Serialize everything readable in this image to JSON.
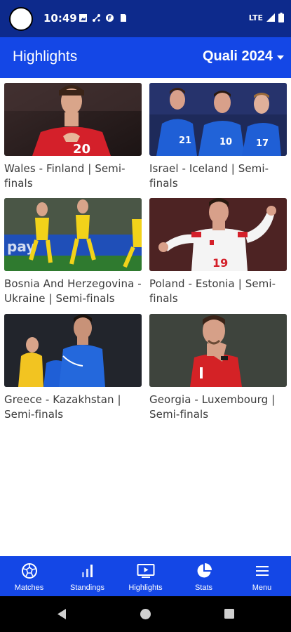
{
  "status_bar": {
    "time": "10:49",
    "network": "LTE"
  },
  "app_bar": {
    "title": "Highlights",
    "season": "Quali 2024"
  },
  "highlights": [
    {
      "caption": "Wales - Finland | Semi-finals"
    },
    {
      "caption": "Israel - Iceland | Semi-finals"
    },
    {
      "caption": "Bosnia And Herzegovina - Ukraine | Semi-finals"
    },
    {
      "caption": "Poland - Estonia | Semi-finals"
    },
    {
      "caption": "Greece - Kazakhstan | Semi-finals"
    },
    {
      "caption": "Georgia - Luxembourg | Semi-finals"
    }
  ],
  "bottom_nav": [
    {
      "label": "Matches",
      "icon": "soccer-ball-icon"
    },
    {
      "label": "Standings",
      "icon": "bar-chart-icon"
    },
    {
      "label": "Highlights",
      "icon": "play-screen-icon"
    },
    {
      "label": "Stats",
      "icon": "pie-chart-icon"
    },
    {
      "label": "Menu",
      "icon": "hamburger-menu-icon"
    }
  ],
  "colors": {
    "status_bar": "#0d2a8c",
    "app_bar": "#1447e6",
    "nav": "#1447e6",
    "caption": "#3a3a3a"
  }
}
